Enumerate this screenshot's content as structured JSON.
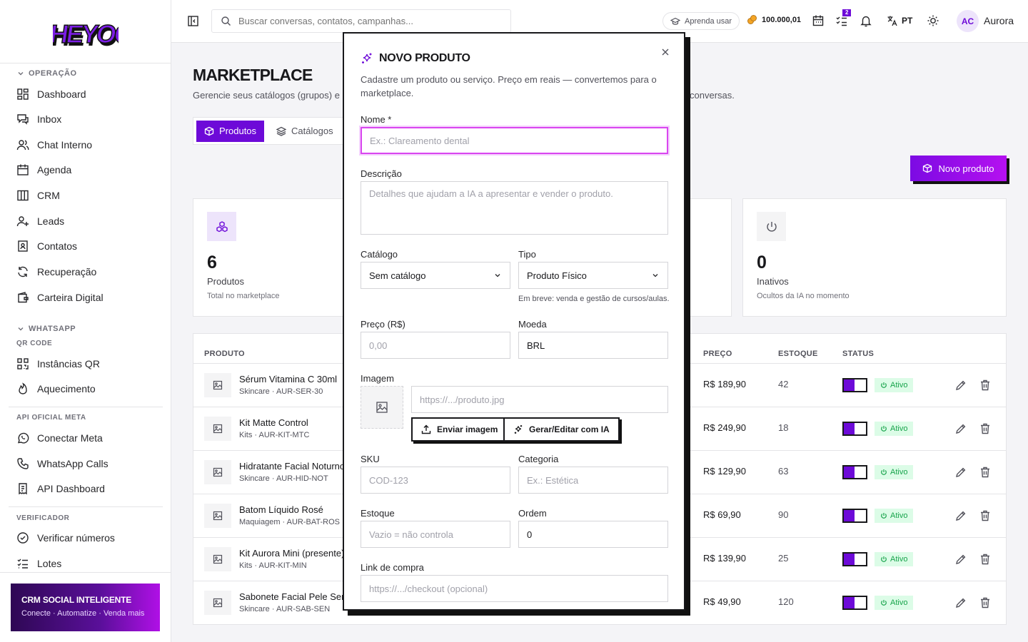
{
  "brand": {
    "logo_text": "HEYOO"
  },
  "sidebar": {
    "section_operacao": "OPERAÇÃO",
    "operacao_items": [
      {
        "label": "Dashboard",
        "icon": "dashboard-icon"
      },
      {
        "label": "Inbox",
        "icon": "inbox-icon"
      },
      {
        "label": "Chat Interno",
        "icon": "users-icon"
      },
      {
        "label": "Agenda",
        "icon": "calendar-icon"
      },
      {
        "label": "CRM",
        "icon": "kanban-icon"
      },
      {
        "label": "Leads",
        "icon": "user-plus-icon"
      },
      {
        "label": "Contatos",
        "icon": "contact-icon"
      },
      {
        "label": "Recuperação",
        "icon": "refresh-icon"
      },
      {
        "label": "Carteira Digital",
        "icon": "wallet-icon"
      }
    ],
    "section_whatsapp": "WHATSAPP",
    "sub_qr": "QR CODE",
    "qr_items": [
      {
        "label": "Instâncias QR",
        "icon": "qr-icon"
      },
      {
        "label": "Aquecimento",
        "icon": "flame-icon"
      }
    ],
    "sub_api": "API OFICIAL META",
    "api_items": [
      {
        "label": "Conectar Meta",
        "icon": "whatsapp-icon"
      },
      {
        "label": "WhatsApp Calls",
        "icon": "phone-icon"
      },
      {
        "label": "API Dashboard",
        "icon": "receipt-icon"
      }
    ],
    "sub_verificador": "VERIFICADOR",
    "verificador_items": [
      {
        "label": "Verificar números",
        "icon": "check-circle-icon"
      },
      {
        "label": "Lotes",
        "icon": "list-check-icon"
      }
    ],
    "promo": {
      "title": "CRM SOCIAL INTELIGENTE",
      "subtitle": "Conecte · Automatize · Venda mais"
    }
  },
  "topbar": {
    "search_placeholder": "Buscar conversas, contatos, campanhas...",
    "learn_label": "Aprenda usar",
    "coins": "100.000,01",
    "tasks_badge": "2",
    "language": "PT",
    "user_initials": "AC",
    "user_name": "Aurora"
  },
  "page": {
    "title": "MARKETPLACE",
    "subtitle_start": "Gerencie seus catálogos (grupos) e p",
    "subtitle_end": "conversas.",
    "tabs": [
      {
        "label": "Produtos",
        "active": true
      },
      {
        "label": "Catálogos",
        "active": false
      }
    ],
    "new_button": "Novo produto"
  },
  "stats": [
    {
      "value": "6",
      "label": "Produtos",
      "hint": "Total no marketplace"
    },
    {
      "value": "0",
      "label": "Inativos",
      "hint": "Ocultos da IA no momento"
    }
  ],
  "table": {
    "headers": {
      "produto": "PRODUTO",
      "preco": "PREÇO",
      "estoque": "ESTOQUE",
      "status": "STATUS"
    },
    "rows": [
      {
        "name": "Sérum Vitamina C 30ml",
        "meta": "Skincare · AUR-SER-30",
        "price": "R$ 189,90",
        "stock": "42",
        "status": "Ativo"
      },
      {
        "name": "Kit Matte Control",
        "meta": "Kits · AUR-KIT-MTC",
        "price": "R$ 249,90",
        "stock": "18",
        "status": "Ativo"
      },
      {
        "name": "Hidratante Facial Noturno",
        "meta": "Skincare · AUR-HID-NOT",
        "price": "R$ 129,90",
        "stock": "63",
        "status": "Ativo"
      },
      {
        "name": "Batom Líquido Rosé",
        "meta": "Maquiagem · AUR-BAT-ROS",
        "price": "R$ 69,90",
        "stock": "90",
        "status": "Ativo"
      },
      {
        "name": "Kit Aurora Mini (presente)",
        "meta": "Kits · AUR-KIT-MIN",
        "price": "R$ 139,90",
        "stock": "25",
        "status": "Ativo"
      },
      {
        "name": "Sabonete Facial Pele Sensível",
        "meta": "Skincare · AUR-SAB-SEN",
        "price": "R$ 49,90",
        "stock": "120",
        "status": "Ativo"
      }
    ]
  },
  "modal": {
    "title": "NOVO PRODUTO",
    "description": "Cadastre um produto ou serviço. Preço em reais — convertemos para o marketplace.",
    "nome_label": "Nome *",
    "nome_placeholder": "Ex.: Clareamento dental",
    "descricao_label": "Descrição",
    "descricao_placeholder": "Detalhes que ajudam a IA a apresentar e vender o produto.",
    "catalogo_label": "Catálogo",
    "catalogo_value": "Sem catálogo",
    "tipo_label": "Tipo",
    "tipo_value": "Produto Físico",
    "tipo_hint": "Em breve: venda e gestão de cursos/aulas.",
    "preco_label": "Preço (R$)",
    "preco_placeholder": "0,00",
    "moeda_label": "Moeda",
    "moeda_value": "BRL",
    "imagem_label": "Imagem",
    "imagem_placeholder": "https://.../produto.jpg",
    "upload_button": "Enviar imagem",
    "ai_button": "Gerar/Editar com IA",
    "sku_label": "SKU",
    "sku_placeholder": "COD-123",
    "categoria_label": "Categoria",
    "categoria_placeholder": "Ex.: Estética",
    "estoque_label": "Estoque",
    "estoque_placeholder": "Vazio = não controla",
    "ordem_label": "Ordem",
    "ordem_value": "0",
    "link_label": "Link de compra",
    "link_placeholder": "https://.../checkout (opcional)"
  },
  "colors": {
    "accent": "#6d0ad8",
    "accent_light": "#ede4fb",
    "success": "#16a34a",
    "focus": "#d946ef"
  }
}
